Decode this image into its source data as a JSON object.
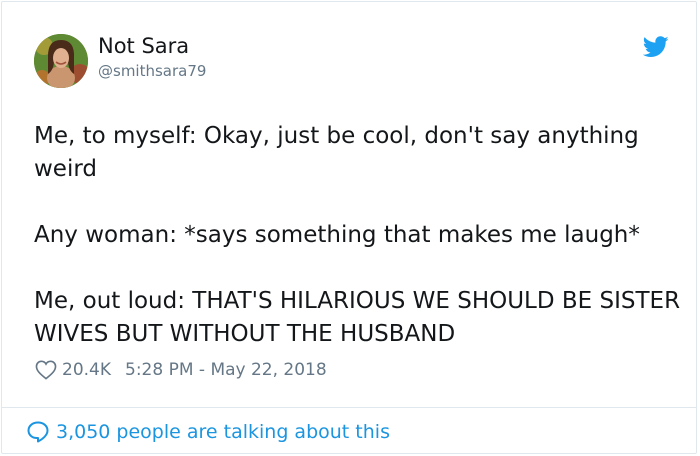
{
  "author": {
    "display_name": "Not Sara",
    "handle": "@smithsara79",
    "avatar_icon": "profile-photo"
  },
  "brand": {
    "icon": "twitter-bird-icon",
    "color": "#1da1f2"
  },
  "tweet": {
    "paragraphs": [
      "Me, to myself: Okay, just be cool, don't say anything weird",
      "Any woman: *says something that makes me laugh*",
      "Me, out loud: THAT'S HILARIOUS WE SHOULD BE SISTER WIVES BUT WITHOUT THE HUSBAND"
    ]
  },
  "meta": {
    "likes": "20.4K",
    "timestamp": "5:28 PM - May 22, 2018",
    "heart_icon": "heart-icon"
  },
  "footer": {
    "talking": "3,050 people are talking about this",
    "icon": "speech-bubble-icon",
    "color": "#1b95e0"
  }
}
